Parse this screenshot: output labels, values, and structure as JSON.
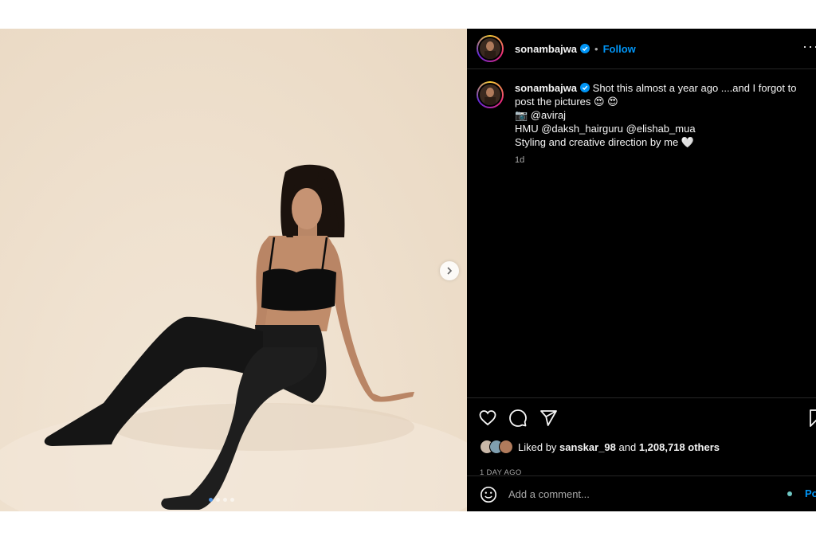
{
  "header": {
    "username": "sonambajwa",
    "separator": "•",
    "follow_label": "Follow",
    "more_label": "···"
  },
  "caption": {
    "username": "sonambajwa",
    "line1": "Shot this almost a year ago ....and I forgot to post the pictures 😍 😍",
    "line2": "📷 @aviraj",
    "line3": "HMU @daksh_hairguru @elishab_mua",
    "line4": "Styling and creative direction by me 🤍",
    "time": "1d"
  },
  "carousel": {
    "slide_count": 4,
    "active_index": 0
  },
  "likes": {
    "prefix": "Liked by",
    "first_user": "sanskar_98",
    "and": "and",
    "others": "1,208,718 others"
  },
  "posted": "1 DAY AGO",
  "comment": {
    "placeholder": "Add a comment...",
    "post_label": "Po"
  },
  "icons": {
    "like": "heart-icon",
    "comment": "comment-icon",
    "share": "send-icon",
    "save": "bookmark-icon",
    "emoji": "smiley-icon",
    "verified": "verified-badge-icon",
    "next": "chevron-right-icon"
  },
  "colors": {
    "link": "#0095f6",
    "background": "#000000",
    "verified": "#0095f6"
  }
}
